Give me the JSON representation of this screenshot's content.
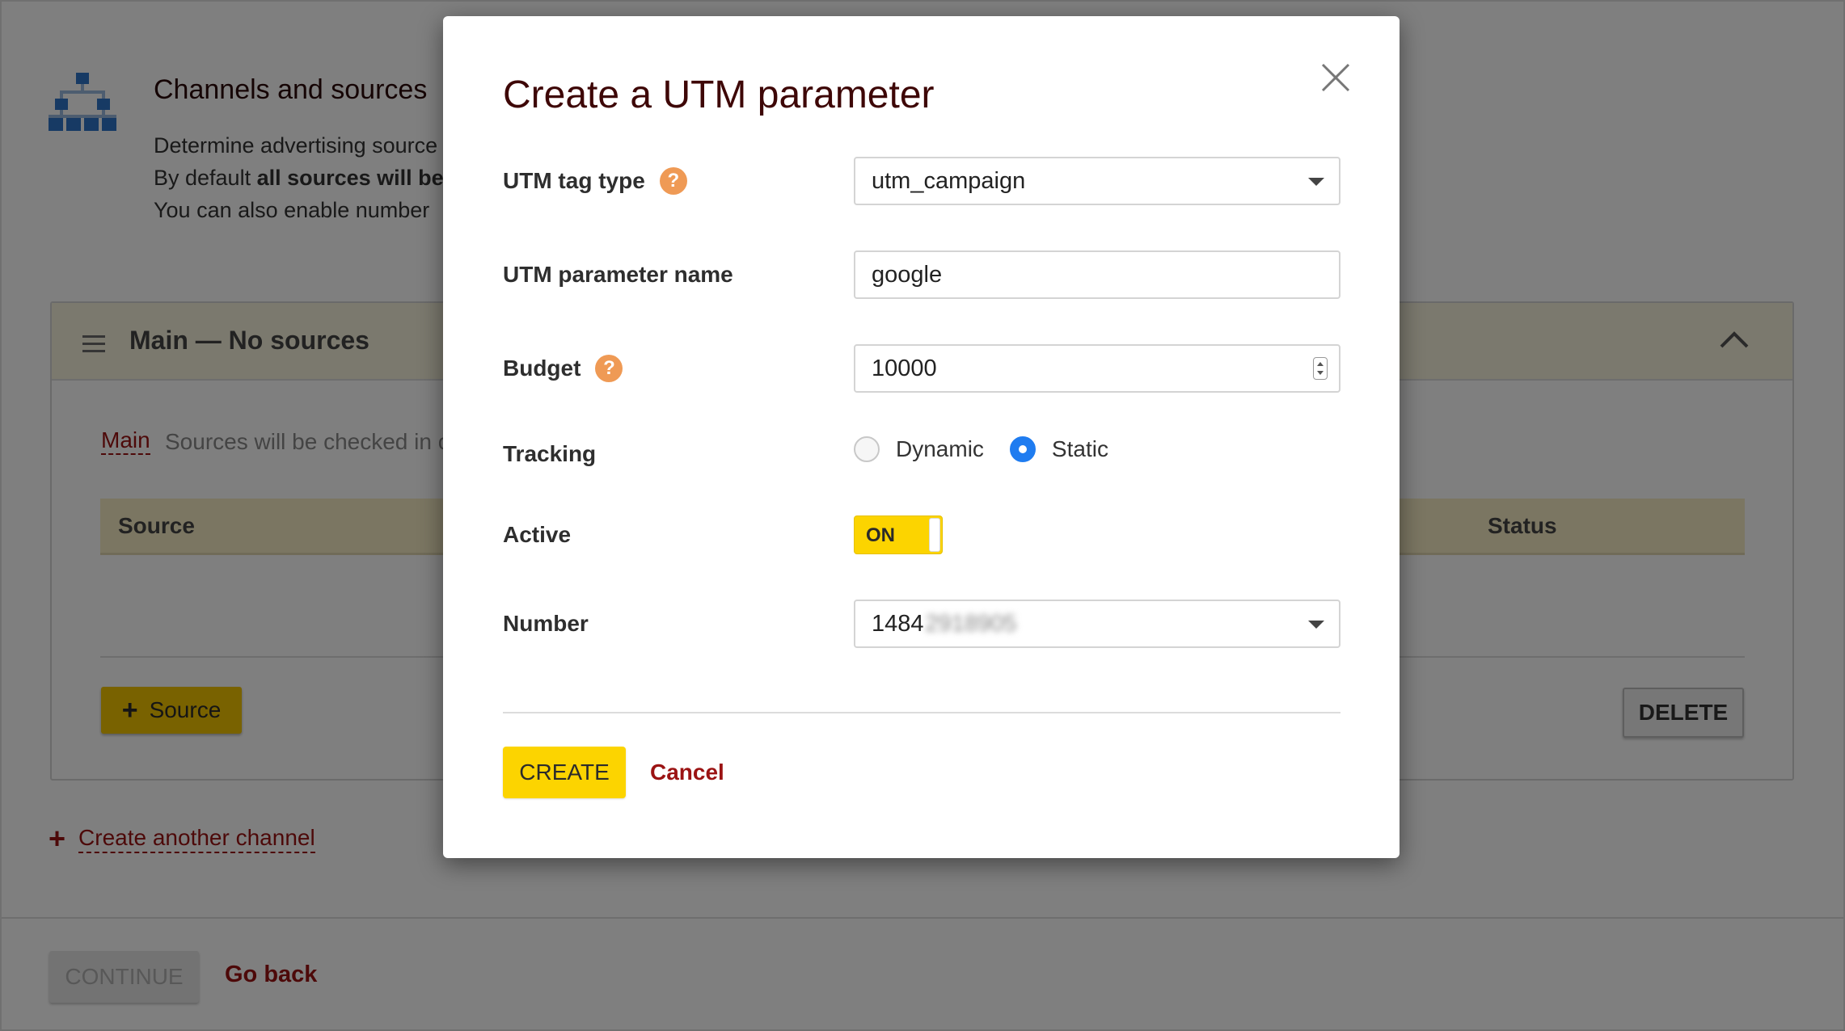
{
  "background": {
    "section": {
      "title": "Channels and sources",
      "desc_line1": "Determine advertising source",
      "desc_line2_prefix": "By default ",
      "desc_line2_bold": "all sources will be",
      "desc_line3": "You can also enable number"
    },
    "channel": {
      "title": "Main — No sources",
      "main_link": "Main",
      "hint": "Sources will be checked in o",
      "col_source": "Source",
      "col_status": "Status",
      "add_source_label": "Source",
      "delete_label": "DELETE"
    },
    "create_channel_label": "Create another channel",
    "continue_label": "CONTINUE",
    "go_back_label": "Go back"
  },
  "modal": {
    "title": "Create a UTM parameter",
    "fields": {
      "tag_type": {
        "label": "UTM tag type",
        "value": "utm_campaign"
      },
      "param_name": {
        "label": "UTM parameter name",
        "value": "google"
      },
      "budget": {
        "label": "Budget",
        "value": "10000"
      },
      "tracking": {
        "label": "Tracking",
        "options": [
          "Dynamic",
          "Static"
        ],
        "selected": "Static"
      },
      "active": {
        "label": "Active",
        "toggle_label": "ON"
      },
      "number": {
        "label": "Number",
        "value_visible": "1484",
        "value_blurred": "2918905"
      }
    },
    "create_label": "CREATE",
    "cancel_label": "Cancel",
    "help_glyph": "?"
  },
  "colors": {
    "accent_yellow": "#fcd400",
    "link_red": "#9b1313",
    "radio_blue": "#1f7cf0",
    "help_orange": "#ef9a55",
    "title_dark": "#3e0707"
  }
}
